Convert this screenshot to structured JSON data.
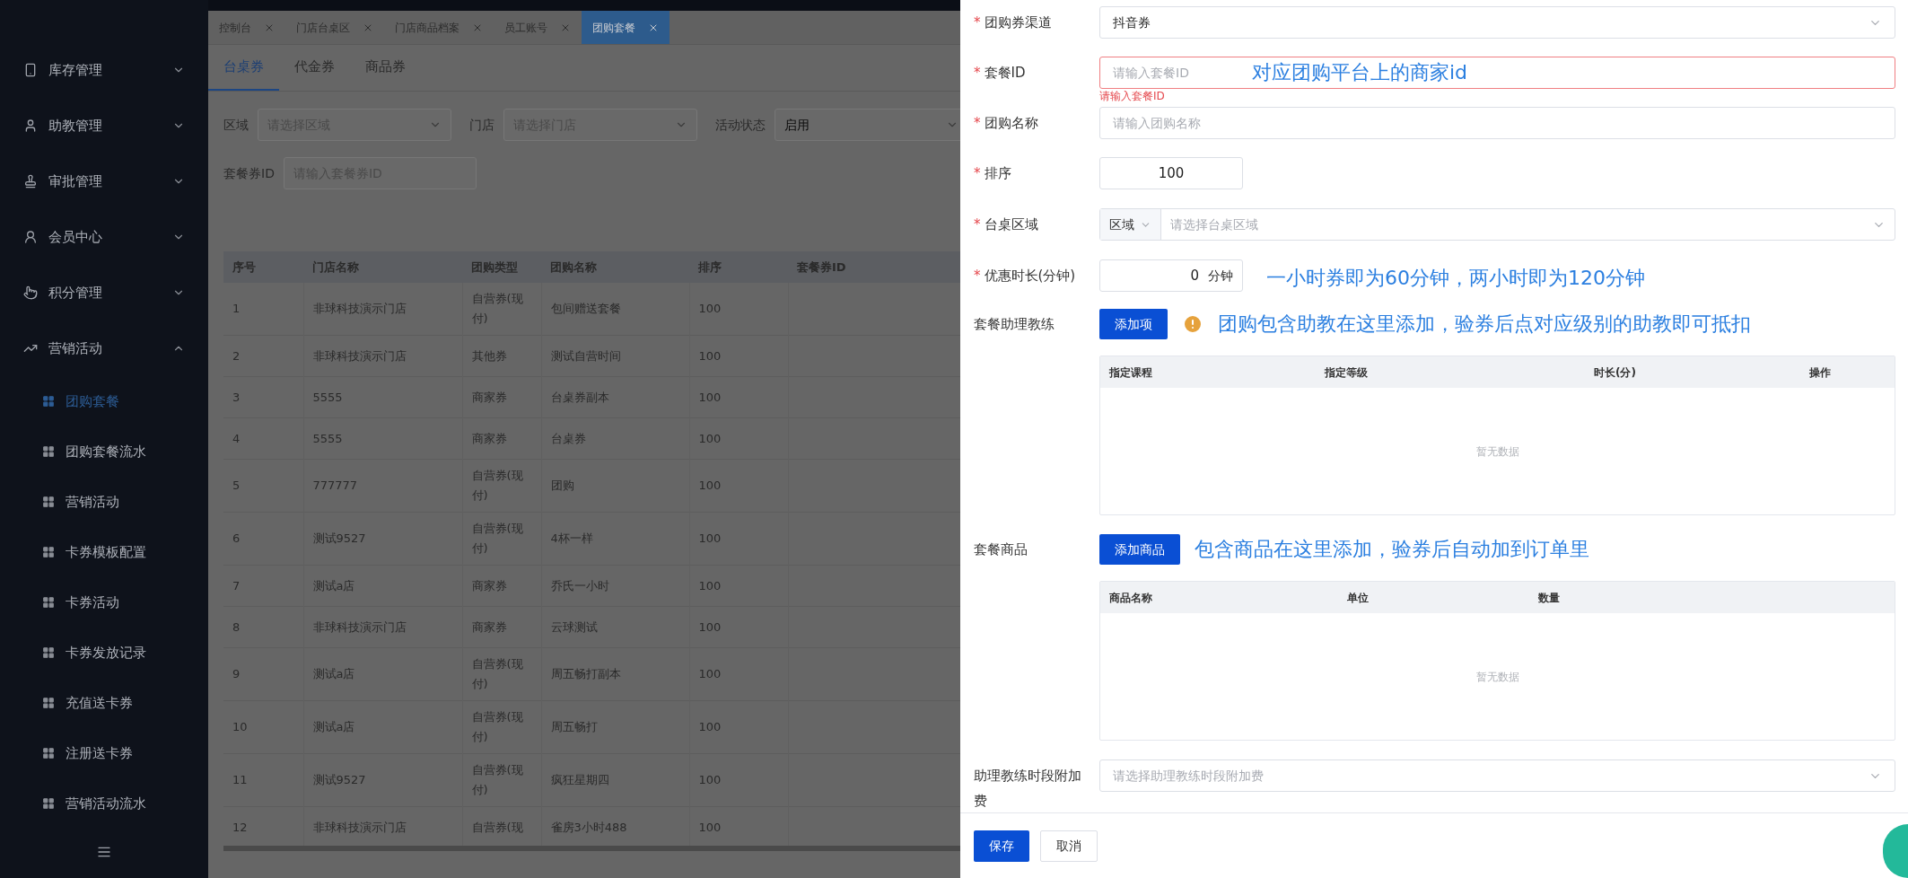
{
  "sidebar": {
    "items": [
      {
        "label": "库存管理",
        "expanded": false
      },
      {
        "label": "助教管理",
        "expanded": false
      },
      {
        "label": "审批管理",
        "expanded": false
      },
      {
        "label": "会员中心",
        "expanded": false
      },
      {
        "label": "积分管理",
        "expanded": false
      },
      {
        "label": "营销活动",
        "expanded": true,
        "children": [
          {
            "label": "团购套餐",
            "selected": true
          },
          {
            "label": "团购套餐流水",
            "selected": false
          },
          {
            "label": "营销活动",
            "selected": false
          },
          {
            "label": "卡券模板配置",
            "selected": false
          },
          {
            "label": "卡券活动",
            "selected": false
          },
          {
            "label": "卡券发放记录",
            "selected": false
          },
          {
            "label": "充值送卡券",
            "selected": false
          },
          {
            "label": "注册送卡券",
            "selected": false
          },
          {
            "label": "营销活动流水",
            "selected": false
          }
        ]
      }
    ]
  },
  "page_tabs": [
    {
      "label": "控制台",
      "selected": false
    },
    {
      "label": "门店台桌区",
      "selected": false
    },
    {
      "label": "门店商品档案",
      "selected": false
    },
    {
      "label": "员工账号",
      "selected": false
    },
    {
      "label": "团购套餐",
      "selected": true
    }
  ],
  "sub_tabs": [
    {
      "label": "台桌券",
      "selected": true
    },
    {
      "label": "代金券",
      "selected": false
    },
    {
      "label": "商品券",
      "selected": false
    }
  ],
  "filters": [
    {
      "kind": "select",
      "label": "区域",
      "placeholder": "请选择区域"
    },
    {
      "kind": "select",
      "label": "门店",
      "placeholder": "请选择门店"
    },
    {
      "kind": "select",
      "label": "活动状态",
      "value": "启用"
    },
    {
      "kind": "input",
      "label": "套餐券ID",
      "placeholder": "请输入套餐券ID"
    }
  ],
  "table": {
    "columns": [
      "序号",
      "门店名称",
      "团购类型",
      "团购名称",
      "排序",
      "套餐券ID"
    ],
    "rows": [
      [
        "1",
        "非球科技演示门店",
        "自营券(现付)",
        "包间赠送套餐",
        "100"
      ],
      [
        "2",
        "非球科技演示门店",
        "其他券",
        "测试自营时间",
        "100"
      ],
      [
        "3",
        "5555",
        "商家券",
        "台桌券副本",
        "100"
      ],
      [
        "4",
        "5555",
        "商家券",
        "台桌券",
        "100"
      ],
      [
        "5",
        "777777",
        "自营券(现付)",
        "团购",
        "100"
      ],
      [
        "6",
        "测试9527",
        "自营券(现付)",
        "4杯一样",
        "100"
      ],
      [
        "7",
        "测试a店",
        "商家券",
        "乔氏一小时",
        "100"
      ],
      [
        "8",
        "非球科技演示门店",
        "商家券",
        "云球测试",
        "100"
      ],
      [
        "9",
        "测试a店",
        "自营券(现付)",
        "周五畅打副本",
        "100"
      ],
      [
        "10",
        "测试a店",
        "自营券(现付)",
        "周五畅打",
        "100"
      ],
      [
        "11",
        "测试9527",
        "自营券(现付)",
        "疯狂星期四",
        "100"
      ],
      [
        "12",
        "非球科技演示门店",
        "自营券(现",
        "雀房3小时488",
        "100"
      ]
    ]
  },
  "form": {
    "fields": [
      {
        "kind": "select",
        "mark": "*",
        "label": "团购券渠道",
        "value": "抖音券"
      },
      {
        "kind": "input",
        "mark": "*",
        "label": "套餐ID",
        "placeholder": "请输入套餐ID",
        "error": "请输入套餐ID",
        "note": "对应团购平台上的商家id"
      },
      {
        "kind": "input",
        "mark": "*",
        "label": "团购名称",
        "placeholder": "请输入团购名称"
      },
      {
        "kind": "number",
        "mark": "*",
        "label": "排序",
        "value": "100"
      },
      {
        "kind": "group_select",
        "mark": "*",
        "label": "台桌区域",
        "prefix": "区域",
        "placeholder": "请选择台桌区域"
      },
      {
        "kind": "number_unit",
        "mark": "*",
        "label": "优惠时长(分钟)",
        "value": "0",
        "unit": "分钟",
        "note": "一小时券即为60分钟，两小时即为120分钟"
      },
      {
        "kind": "table",
        "label": "套餐助理教练",
        "button": "添加项",
        "warning": true,
        "note": "团购包含助教在这里添加，验券后点对应级别的助教即可抵扣",
        "columns": [
          "指定课程",
          "指定等级",
          "时长(分)",
          "操作"
        ],
        "empty": "暂无数据"
      },
      {
        "kind": "table",
        "label": "套餐商品",
        "button": "添加商品",
        "warning": false,
        "note": "包含商品在这里添加，验券后自动加到订单里",
        "columns": [
          "商品名称",
          "单位",
          "数量"
        ],
        "empty": "暂无数据"
      },
      {
        "kind": "select",
        "label": "助理教练时段附加费",
        "placeholder": "请选择助理教练时段附加费"
      }
    ]
  },
  "footer_buttons": [
    {
      "kind": "primary",
      "label": "保存"
    },
    {
      "kind": "default",
      "label": "取消"
    }
  ]
}
